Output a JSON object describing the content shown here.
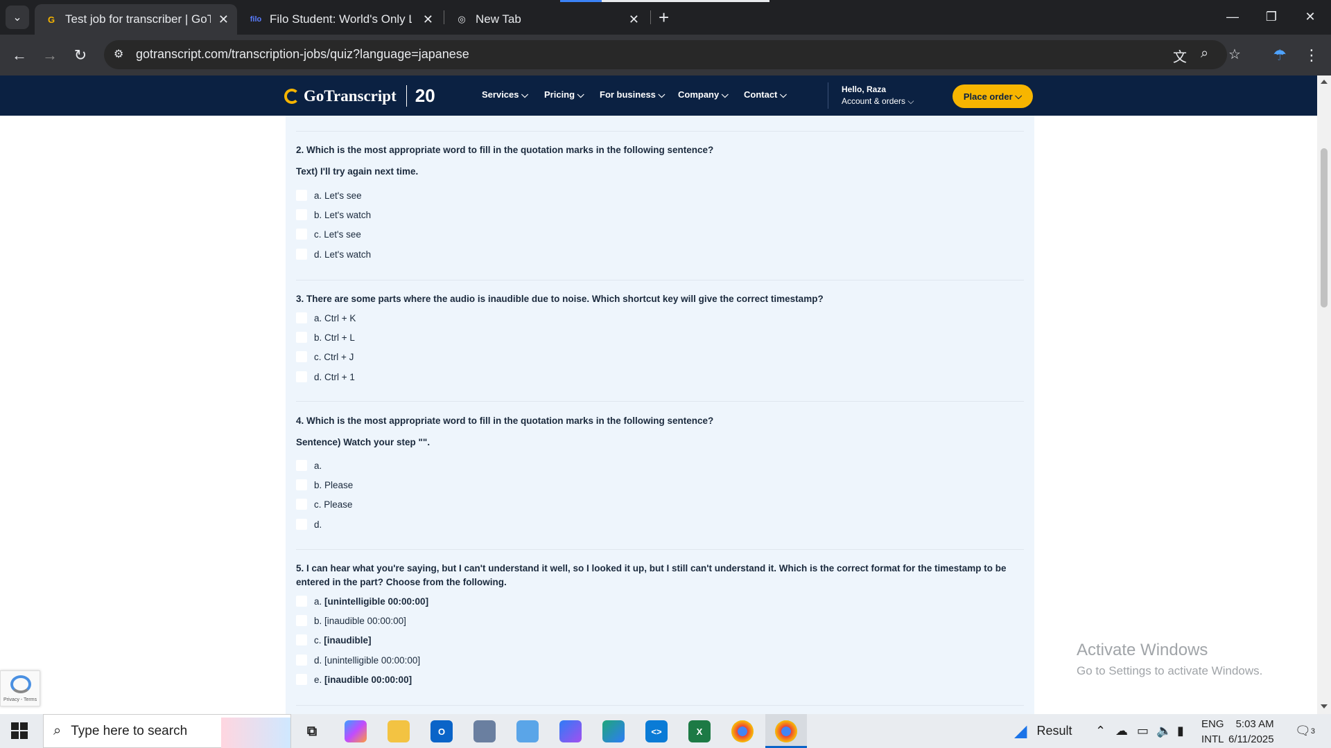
{
  "browser": {
    "tabs": [
      {
        "title": "Test job for transcriber | GoTranscript",
        "active": true
      },
      {
        "title": "Filo Student: World's Only Live Instant Tutoring",
        "active": false
      },
      {
        "title": "New Tab",
        "active": false
      }
    ],
    "url": "gotranscript.com/transcription-jobs/quiz?language=japanese"
  },
  "site": {
    "logo": "GoTranscript",
    "anniversary": "20",
    "nav": [
      "Services",
      "Pricing",
      "For business",
      "Company",
      "Contact"
    ],
    "greeting": "Hello, Raza",
    "account": "Account & orders",
    "cta": "Place order"
  },
  "quiz": {
    "questions": [
      {
        "text": "2. Which is the most appropriate word to fill in the quotation marks in the following sentence?",
        "subtext": "Text) I'll try again next time.",
        "options": [
          "a. Let's see",
          "b. Let's watch",
          "c. Let's see",
          "d. Let's watch"
        ]
      },
      {
        "text": "3. There are some parts where the audio is inaudible due to noise. Which shortcut key will give the correct timestamp?",
        "subtext": "",
        "options": [
          "a. Ctrl + K",
          "b. Ctrl + L",
          "c. Ctrl + J",
          "d. Ctrl + 1"
        ]
      },
      {
        "text": "4. Which is the most appropriate word to fill in the quotation marks in the following sentence?",
        "subtext": "Sentence) Watch your step \"\".",
        "options": [
          "a.",
          "b. Please",
          "c. Please",
          "d."
        ]
      },
      {
        "text": "5. I can hear what you're saying, but I can't understand it well, so I looked it up, but I still can't understand it. Which is the correct format for the timestamp to be entered in the part? Choose from the following.",
        "subtext": "",
        "options": [
          {
            "prefix": "a.",
            "value": "[unintelligible 00:00:00]",
            "bold": true
          },
          {
            "prefix": "b.",
            "value": "[inaudible 00:00:00]",
            "bold": false
          },
          {
            "prefix": "c.",
            "value": "[inaudible]",
            "bold": true
          },
          {
            "prefix": "d.",
            "value": "[unintelligible 00:00:00]",
            "bold": false
          },
          {
            "prefix": "e.",
            "value": "[inaudible 00:00:00]",
            "bold": true
          }
        ]
      }
    ]
  },
  "watermark": {
    "line1": "Activate Windows",
    "line2": "Go to Settings to activate Windows."
  },
  "recaptcha": {
    "text": "Privacy - Terms"
  },
  "taskbar": {
    "search_placeholder": "Type here to search",
    "weather": "Result",
    "lang1": "ENG",
    "lang2": "INTL",
    "time": "5:03 AM",
    "date": "6/11/2025",
    "notifications": "3"
  },
  "colors": {
    "header": "#0b2142",
    "accent": "#f7b500",
    "card": "#eef5fc"
  }
}
